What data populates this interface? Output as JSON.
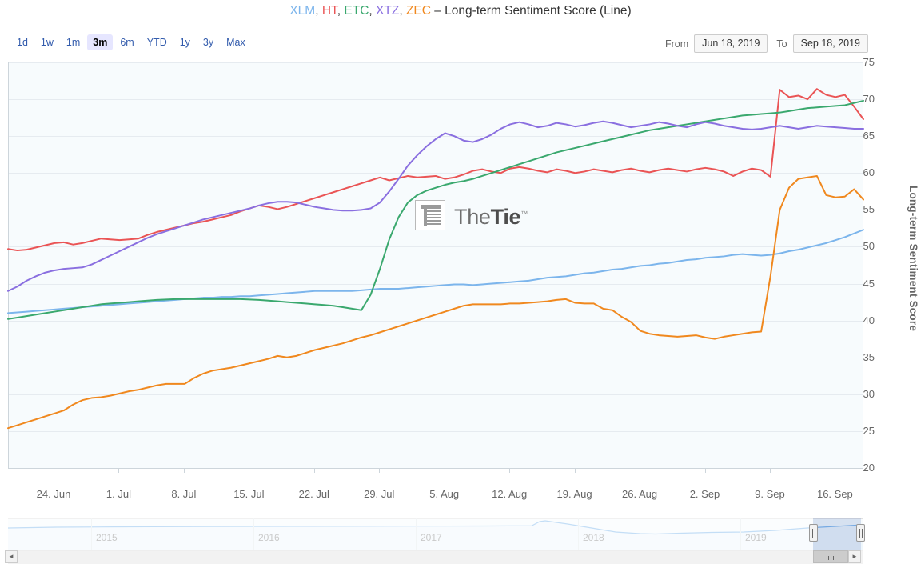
{
  "header": {
    "title_suffix": "– Long-term Sentiment Score (Line)",
    "tickers": [
      {
        "symbol": "XLM",
        "color": "#7cb5ec"
      },
      {
        "symbol": "HT",
        "color": "#ea5455"
      },
      {
        "symbol": "ETC",
        "color": "#3aa86e"
      },
      {
        "symbol": "XTZ",
        "color": "#8a6fe0"
      },
      {
        "symbol": "ZEC",
        "color": "#f0881e"
      }
    ],
    "separator": ", "
  },
  "range_selector": {
    "buttons": [
      "1d",
      "1w",
      "1m",
      "3m",
      "6m",
      "YTD",
      "1y",
      "3y",
      "Max"
    ],
    "active": "3m",
    "from_label": "From",
    "to_label": "To",
    "from_value": "Jun 18, 2019",
    "to_value": "Sep 18, 2019"
  },
  "watermark": {
    "text_light": "The",
    "text_bold": "Tie",
    "trademark": "™"
  },
  "navigator": {
    "years": [
      "2015",
      "2016",
      "2017",
      "2018",
      "2019"
    ],
    "scroll_left_glyph": "◄",
    "scroll_right_glyph": "►"
  },
  "chart_data": {
    "type": "line",
    "title": "XLM, HT, ETC, XTZ, ZEC – Long-term Sentiment Score (Line)",
    "xlabel": "",
    "ylabel": "Long-term Sentiment Score",
    "ylim": [
      20,
      75
    ],
    "yticks": [
      20,
      25,
      30,
      35,
      40,
      45,
      50,
      55,
      60,
      65,
      70,
      75
    ],
    "grid": true,
    "legend": "none",
    "x_range": [
      "Jun 18, 2019",
      "Sep 18, 2019"
    ],
    "xticks": [
      "24. Jun",
      "1. Jul",
      "8. Jul",
      "15. Jul",
      "22. Jul",
      "29. Jul",
      "5. Aug",
      "12. Aug",
      "19. Aug",
      "26. Aug",
      "2. Sep",
      "9. Sep",
      "16. Sep"
    ],
    "x": [
      0,
      1,
      2,
      3,
      4,
      5,
      6,
      7,
      8,
      9,
      10,
      11,
      12,
      13,
      14,
      15,
      16,
      17,
      18,
      19,
      20,
      21,
      22,
      23,
      24,
      25,
      26,
      27,
      28,
      29,
      30,
      31,
      32,
      33,
      34,
      35,
      36,
      37,
      38,
      39,
      40,
      41,
      42,
      43,
      44,
      45,
      46,
      47,
      48,
      49,
      50,
      51,
      52,
      53,
      54,
      55,
      56,
      57,
      58,
      59,
      60,
      61,
      62,
      63,
      64,
      65,
      66,
      67,
      68,
      69,
      70,
      71,
      72,
      73,
      74,
      75,
      76,
      77,
      78,
      79,
      80,
      81,
      82,
      83,
      84,
      85,
      86,
      87,
      88,
      89,
      90,
      91,
      92
    ],
    "series": [
      {
        "name": "XLM",
        "color": "#7cb5ec",
        "values": [
          41.0,
          41.1,
          41.2,
          41.3,
          41.4,
          41.5,
          41.6,
          41.7,
          41.8,
          41.9,
          42.0,
          42.1,
          42.2,
          42.3,
          42.4,
          42.5,
          42.6,
          42.7,
          42.8,
          42.9,
          43.0,
          43.1,
          43.1,
          43.2,
          43.2,
          43.3,
          43.3,
          43.4,
          43.5,
          43.6,
          43.7,
          43.8,
          43.9,
          44.0,
          44.0,
          44.0,
          44.0,
          44.0,
          44.1,
          44.2,
          44.3,
          44.3,
          44.3,
          44.4,
          44.5,
          44.6,
          44.7,
          44.8,
          44.9,
          44.9,
          44.8,
          44.9,
          45.0,
          45.1,
          45.2,
          45.3,
          45.4,
          45.6,
          45.8,
          45.9,
          46.0,
          46.2,
          46.4,
          46.5,
          46.7,
          46.9,
          47.0,
          47.2,
          47.4,
          47.5,
          47.7,
          47.8,
          48.0,
          48.2,
          48.3,
          48.5,
          48.6,
          48.7,
          48.9,
          49.0,
          48.9,
          48.8,
          48.9,
          49.1,
          49.4,
          49.6,
          49.9,
          50.2,
          50.5,
          50.9,
          51.3,
          51.8,
          52.3
        ]
      },
      {
        "name": "HT",
        "color": "#ea5455",
        "values": [
          49.7,
          49.5,
          49.6,
          49.9,
          50.2,
          50.5,
          50.6,
          50.3,
          50.5,
          50.8,
          51.1,
          51.0,
          50.9,
          51.0,
          51.1,
          51.6,
          52.0,
          52.3,
          52.6,
          52.9,
          53.2,
          53.4,
          53.7,
          54.0,
          54.3,
          54.8,
          55.2,
          55.6,
          55.4,
          55.1,
          55.4,
          55.8,
          56.2,
          56.6,
          57.0,
          57.4,
          57.8,
          58.2,
          58.6,
          59.0,
          59.4,
          59.0,
          59.3,
          59.6,
          59.4,
          59.5,
          59.6,
          59.2,
          59.4,
          59.8,
          60.3,
          60.5,
          60.2,
          60.0,
          60.6,
          60.8,
          60.6,
          60.3,
          60.1,
          60.5,
          60.3,
          60.0,
          60.2,
          60.5,
          60.3,
          60.1,
          60.4,
          60.6,
          60.3,
          60.1,
          60.4,
          60.6,
          60.4,
          60.2,
          60.5,
          60.7,
          60.5,
          60.2,
          59.6,
          60.2,
          60.6,
          60.4,
          59.5,
          71.3,
          70.3,
          70.5,
          70.0,
          71.4,
          70.6,
          70.3,
          70.6,
          69.0,
          67.3
        ]
      },
      {
        "name": "ETC",
        "color": "#3aa86e",
        "values": [
          40.2,
          40.4,
          40.6,
          40.8,
          41.0,
          41.2,
          41.4,
          41.6,
          41.8,
          42.0,
          42.2,
          42.3,
          42.4,
          42.5,
          42.6,
          42.7,
          42.8,
          42.85,
          42.9,
          42.9,
          42.9,
          42.9,
          42.9,
          42.9,
          42.9,
          42.9,
          42.85,
          42.8,
          42.7,
          42.6,
          42.5,
          42.4,
          42.3,
          42.2,
          42.1,
          42.0,
          41.8,
          41.6,
          41.4,
          43.5,
          47.0,
          51.0,
          54.0,
          56.0,
          57.0,
          57.6,
          58.0,
          58.4,
          58.7,
          58.9,
          59.2,
          59.6,
          60.0,
          60.4,
          60.8,
          61.2,
          61.6,
          62.0,
          62.4,
          62.8,
          63.1,
          63.4,
          63.7,
          64.0,
          64.3,
          64.6,
          64.9,
          65.2,
          65.5,
          65.8,
          66.0,
          66.2,
          66.4,
          66.6,
          66.8,
          67.0,
          67.2,
          67.4,
          67.6,
          67.8,
          67.9,
          68.0,
          68.1,
          68.2,
          68.4,
          68.6,
          68.8,
          68.9,
          69.0,
          69.1,
          69.2,
          69.5,
          69.8
        ]
      },
      {
        "name": "XTZ",
        "color": "#8a6fe0",
        "values": [
          44.0,
          44.6,
          45.4,
          46.0,
          46.5,
          46.8,
          47.0,
          47.1,
          47.2,
          47.6,
          48.2,
          48.8,
          49.4,
          50.0,
          50.6,
          51.2,
          51.7,
          52.1,
          52.5,
          52.9,
          53.3,
          53.7,
          54.0,
          54.3,
          54.6,
          54.9,
          55.2,
          55.6,
          55.9,
          56.1,
          56.1,
          56.0,
          55.7,
          55.4,
          55.2,
          55.0,
          54.9,
          54.9,
          55.0,
          55.2,
          56.0,
          57.5,
          59.2,
          61.0,
          62.4,
          63.6,
          64.6,
          65.4,
          65.0,
          64.4,
          64.2,
          64.6,
          65.2,
          66.0,
          66.6,
          66.9,
          66.6,
          66.2,
          66.4,
          66.8,
          66.6,
          66.3,
          66.5,
          66.8,
          67.0,
          66.8,
          66.5,
          66.2,
          66.4,
          66.6,
          66.9,
          66.7,
          66.4,
          66.2,
          66.6,
          66.9,
          66.7,
          66.4,
          66.2,
          66.0,
          65.9,
          66.0,
          66.2,
          66.4,
          66.2,
          66.0,
          66.2,
          66.4,
          66.3,
          66.2,
          66.1,
          66.0,
          66.0
        ]
      },
      {
        "name": "ZEC",
        "color": "#f0881e",
        "values": [
          25.4,
          25.8,
          26.2,
          26.6,
          27.0,
          27.4,
          27.8,
          28.6,
          29.2,
          29.5,
          29.6,
          29.8,
          30.1,
          30.4,
          30.6,
          30.9,
          31.2,
          31.4,
          31.4,
          31.4,
          32.2,
          32.8,
          33.2,
          33.4,
          33.6,
          33.9,
          34.2,
          34.5,
          34.8,
          35.2,
          35.0,
          35.2,
          35.6,
          36.0,
          36.3,
          36.6,
          36.9,
          37.3,
          37.7,
          38.0,
          38.4,
          38.8,
          39.2,
          39.6,
          40.0,
          40.4,
          40.8,
          41.2,
          41.6,
          42.0,
          42.2,
          42.2,
          42.2,
          42.2,
          42.3,
          42.3,
          42.4,
          42.5,
          42.6,
          42.8,
          42.9,
          42.4,
          42.3,
          42.3,
          41.6,
          41.4,
          40.5,
          39.8,
          38.6,
          38.2,
          38.0,
          37.9,
          37.8,
          37.9,
          38.0,
          37.7,
          37.5,
          37.8,
          38.0,
          38.2,
          38.4,
          38.5,
          46.0,
          55.0,
          58.0,
          59.2,
          59.4,
          59.6,
          57.0,
          56.7,
          56.8,
          57.8,
          56.4
        ]
      }
    ]
  }
}
